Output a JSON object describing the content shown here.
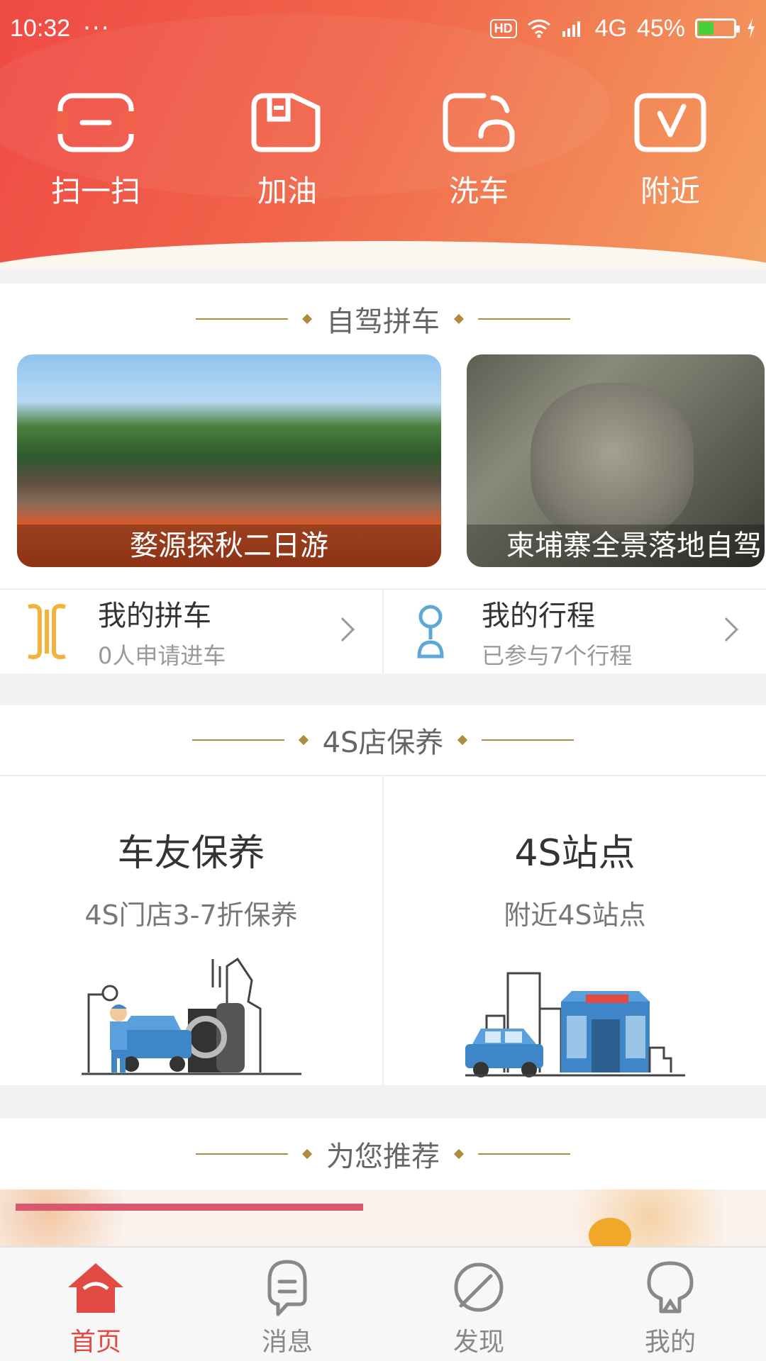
{
  "status": {
    "time": "10:32",
    "dots": "···",
    "hd": "HD",
    "network": "4G",
    "battery": "45%"
  },
  "quick_actions": [
    {
      "label": "扫一扫",
      "icon": "scan-icon"
    },
    {
      "label": "加油",
      "icon": "fuel-icon"
    },
    {
      "label": "洗车",
      "icon": "car-wash-icon"
    },
    {
      "label": "附近",
      "icon": "nearby-icon"
    }
  ],
  "carpool": {
    "title": "自驾拼车",
    "cards": [
      "婺源探秋二日游",
      "柬埔寨全景落地自驾"
    ],
    "my_carpool": {
      "title": "我的拼车",
      "sub": "0人申请进车"
    },
    "my_trips": {
      "title": "我的行程",
      "sub": "已参与7个行程"
    }
  },
  "maintenance": {
    "title": "4S店保养",
    "left": {
      "title": "车友保养",
      "sub": "4S门店3-7折保养"
    },
    "right": {
      "title": "4S站点",
      "sub": "附近4S站点"
    }
  },
  "recommend": {
    "title": "为您推荐"
  },
  "tabs": [
    {
      "label": "首页",
      "active": true
    },
    {
      "label": "消息",
      "active": false
    },
    {
      "label": "发现",
      "active": false
    },
    {
      "label": "我的",
      "active": false
    }
  ],
  "colors": {
    "accent": "#e24a44",
    "gold": "#b08a3e"
  }
}
